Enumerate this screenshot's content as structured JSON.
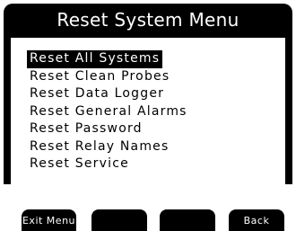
{
  "window": {
    "title": "Reset System Menu"
  },
  "menu": {
    "items": [
      {
        "label": "Reset All Systems",
        "selected": true
      },
      {
        "label": "Reset Clean Probes",
        "selected": false
      },
      {
        "label": "Reset Data Logger",
        "selected": false
      },
      {
        "label": "Reset General Alarms",
        "selected": false
      },
      {
        "label": "Reset Password",
        "selected": false
      },
      {
        "label": "Reset Relay Names",
        "selected": false
      },
      {
        "label": "Reset Service",
        "selected": false
      }
    ]
  },
  "softkeys": {
    "key1": "Exit Menu",
    "key2": "",
    "key3": "",
    "key4": "Back"
  },
  "colors": {
    "background": "#ffffff",
    "frame": "#000000",
    "title_text": "#ffffff",
    "selection_bg": "#000000",
    "selection_text": "#ffffff"
  }
}
